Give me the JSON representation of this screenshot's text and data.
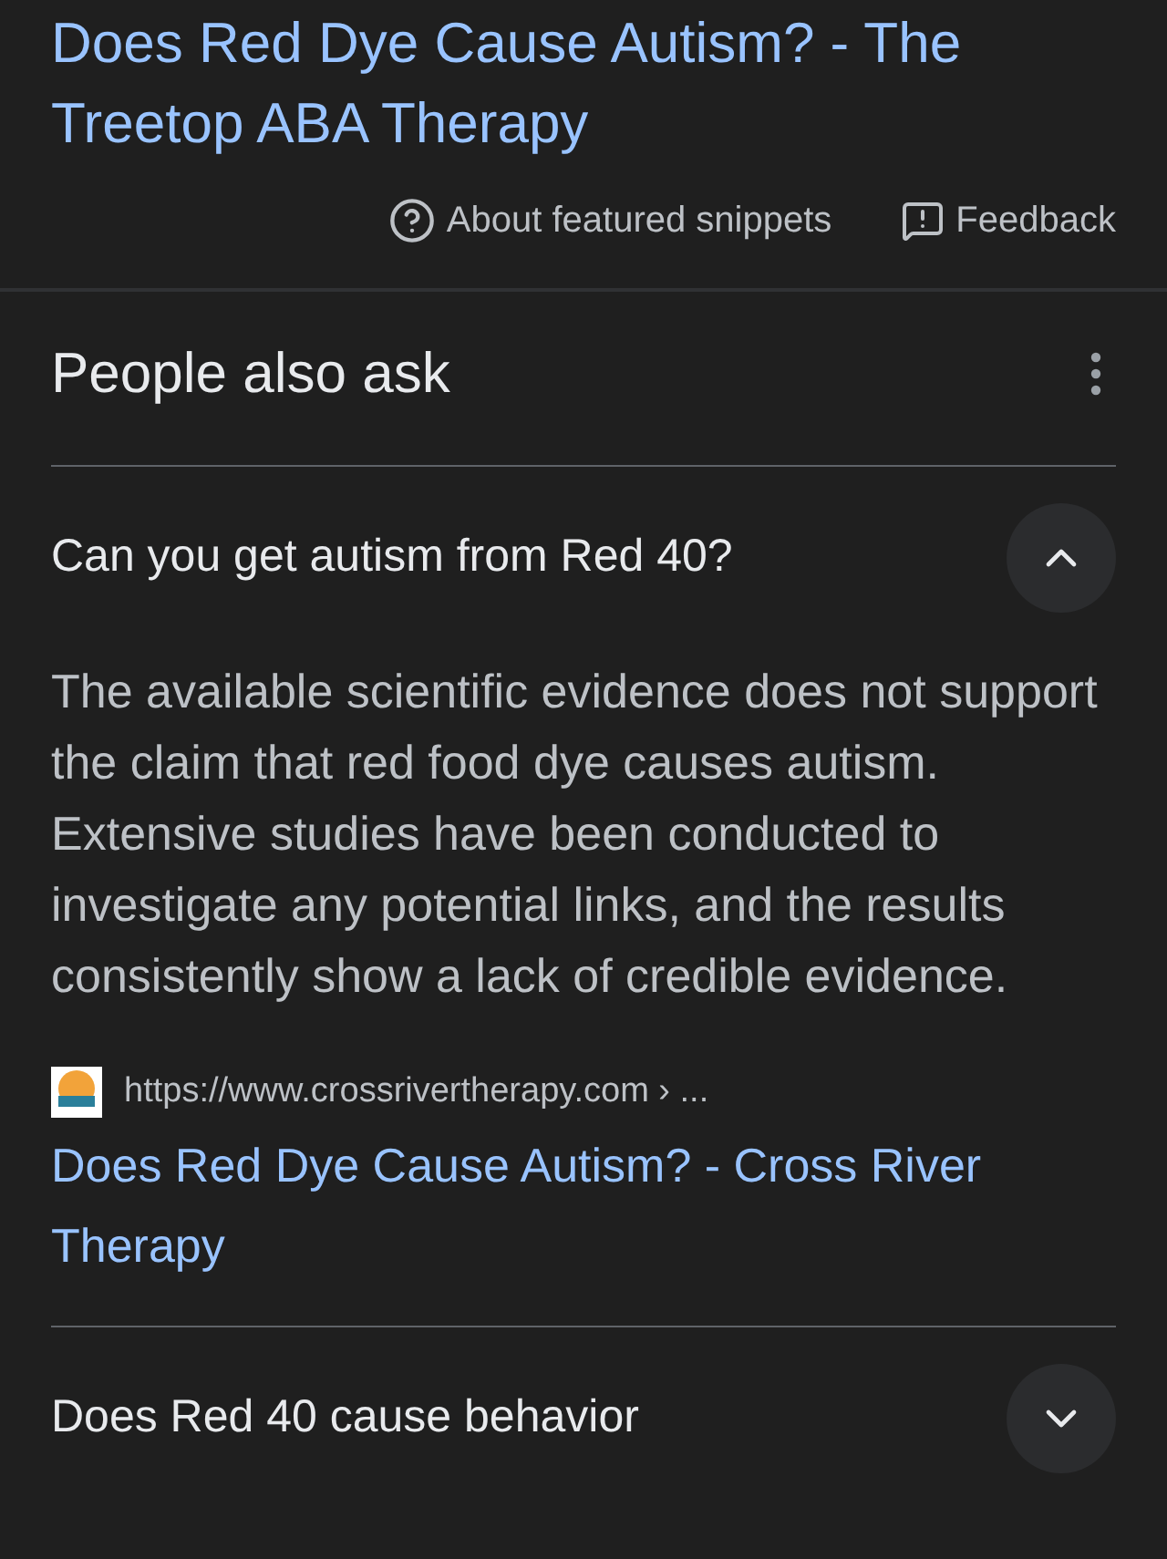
{
  "result_title": "Does Red Dye Cause Autism? - The Treetop ABA Therapy",
  "snippet_links": [
    {
      "kind": "help",
      "label": "About featured snippets"
    },
    {
      "kind": "feedback",
      "label": "Feedback"
    }
  ],
  "people_also_ask": {
    "heading": "People also ask",
    "questions": [
      {
        "question": "Can you get autism from Red 40?",
        "expanded": true,
        "answer": "The available scientific evidence does not support the claim that red food dye causes autism. Extensive studies have been conducted to investigate any potential links, and the results consistently show a lack of credible evidence.",
        "source_url": "https://www.crossrivertherapy.com › ...",
        "source_title": "Does Red Dye Cause Autism? - Cross River Therapy"
      },
      {
        "question": "Does Red 40 cause behavior",
        "expanded": false
      }
    ]
  }
}
